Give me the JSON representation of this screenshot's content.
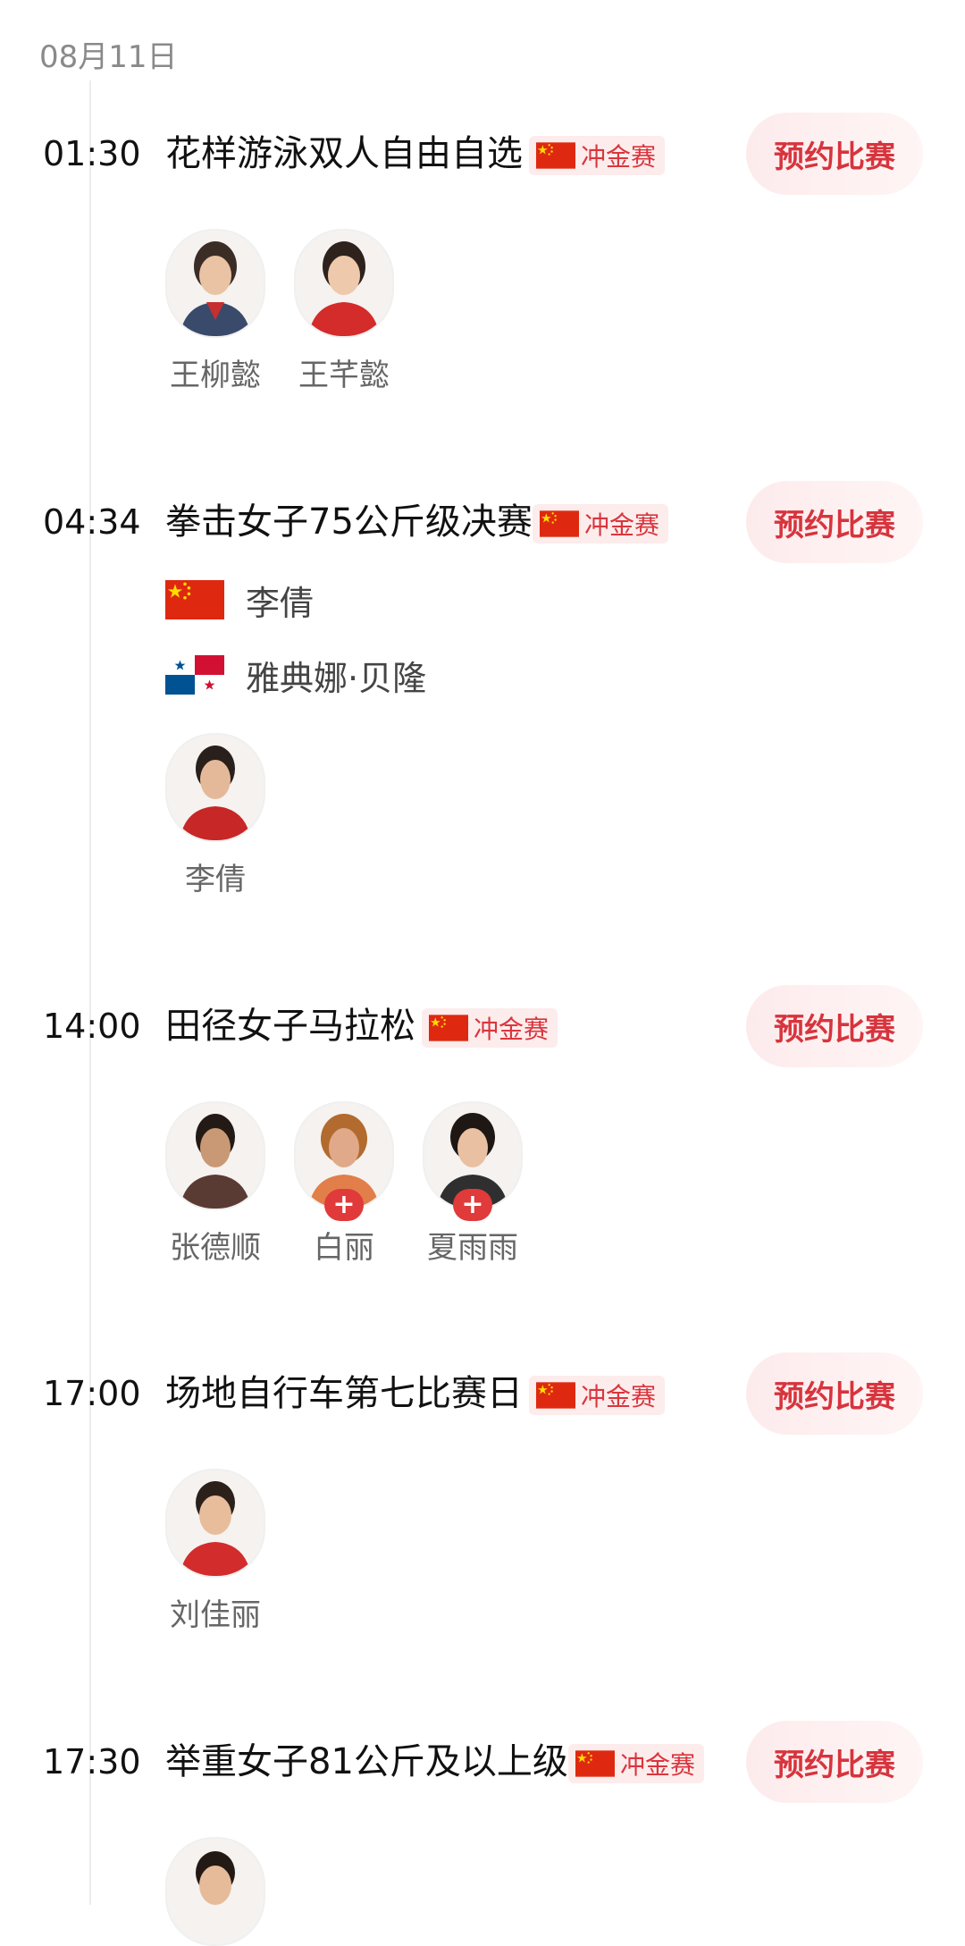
{
  "date": "08月11日",
  "reserve_label": "预约比赛",
  "badge_label": "冲金赛",
  "events": [
    {
      "time": "01:30",
      "title": "花样游泳双人自由自选",
      "athletes": [
        {
          "name": "王柳懿",
          "swiss_flag": false
        },
        {
          "name": "王芊懿",
          "swiss_flag": false
        }
      ]
    },
    {
      "time": "04:34",
      "title": "拳击女子75公斤级决赛",
      "matchup": [
        {
          "country": "China",
          "name": "李倩"
        },
        {
          "country": "Panama",
          "name": "雅典娜·贝隆"
        }
      ],
      "athletes": [
        {
          "name": "李倩",
          "swiss_flag": false
        }
      ]
    },
    {
      "time": "14:00",
      "title": "田径女子马拉松",
      "athletes": [
        {
          "name": "张德顺",
          "swiss_flag": false
        },
        {
          "name": "白丽",
          "swiss_flag": true
        },
        {
          "name": "夏雨雨",
          "swiss_flag": true
        }
      ]
    },
    {
      "time": "17:00",
      "title": "场地自行车第七比赛日",
      "athletes": [
        {
          "name": "刘佳丽",
          "swiss_flag": false
        }
      ]
    },
    {
      "time": "17:30",
      "title": "举重女子81公斤及以上级",
      "athletes": []
    }
  ],
  "colors": {
    "accent_red": "#d7343d",
    "badge_bg": "#fdecec",
    "button_bg": "#fdebec",
    "muted_text": "#8a8a8a"
  },
  "icons": {
    "china_flag": "china-flag-icon",
    "panama_flag": "panama-flag-icon",
    "swiss_flag": "switzerland-flag-icon"
  }
}
